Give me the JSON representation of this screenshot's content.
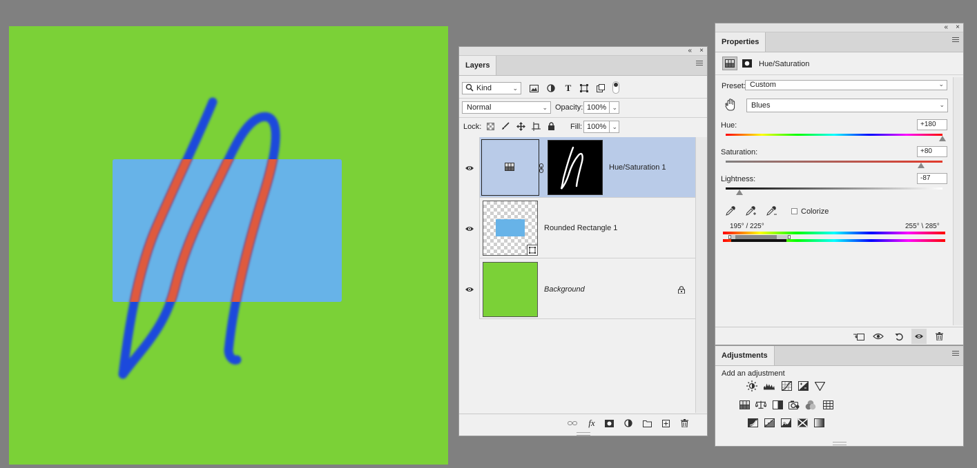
{
  "layers_panel": {
    "tab": "Layers",
    "filter_kind": "Kind",
    "blend_mode": "Normal",
    "opacity_label": "Opacity:",
    "opacity_value": "100%",
    "lock_label": "Lock:",
    "fill_label": "Fill:",
    "fill_value": "100%",
    "layers": [
      {
        "name": "Hue/Saturation 1",
        "visible": true,
        "selected": true
      },
      {
        "name": "Rounded Rectangle 1",
        "visible": true,
        "selected": false
      },
      {
        "name": "Background",
        "visible": true,
        "selected": false,
        "locked": true
      }
    ]
  },
  "properties_panel": {
    "tab": "Properties",
    "adjustment_title": "Hue/Saturation",
    "preset_label": "Preset:",
    "preset_value": "Custom",
    "channel_value": "Blues",
    "hue_label": "Hue:",
    "hue_value": "+180",
    "hue_level": 180,
    "saturation_label": "Saturation:",
    "saturation_value": "+80",
    "saturation_level": 80,
    "lightness_label": "Lightness:",
    "lightness_value": "-87",
    "lightness_level": -87,
    "colorize_label": "Colorize",
    "colorize_checked": false,
    "range_left": "195° / 225°",
    "range_right": "255° \\ 285°"
  },
  "adjustments_panel": {
    "tab": "Adjustments",
    "subtitle": "Add an adjustment"
  },
  "colors": {
    "canvas_green": "#7bd137",
    "rectangle_blue": "#67b3e8",
    "stroke_blue": "#1a48dc",
    "stroke_red": "#df5a3e",
    "selection": "#b9cbe8"
  }
}
